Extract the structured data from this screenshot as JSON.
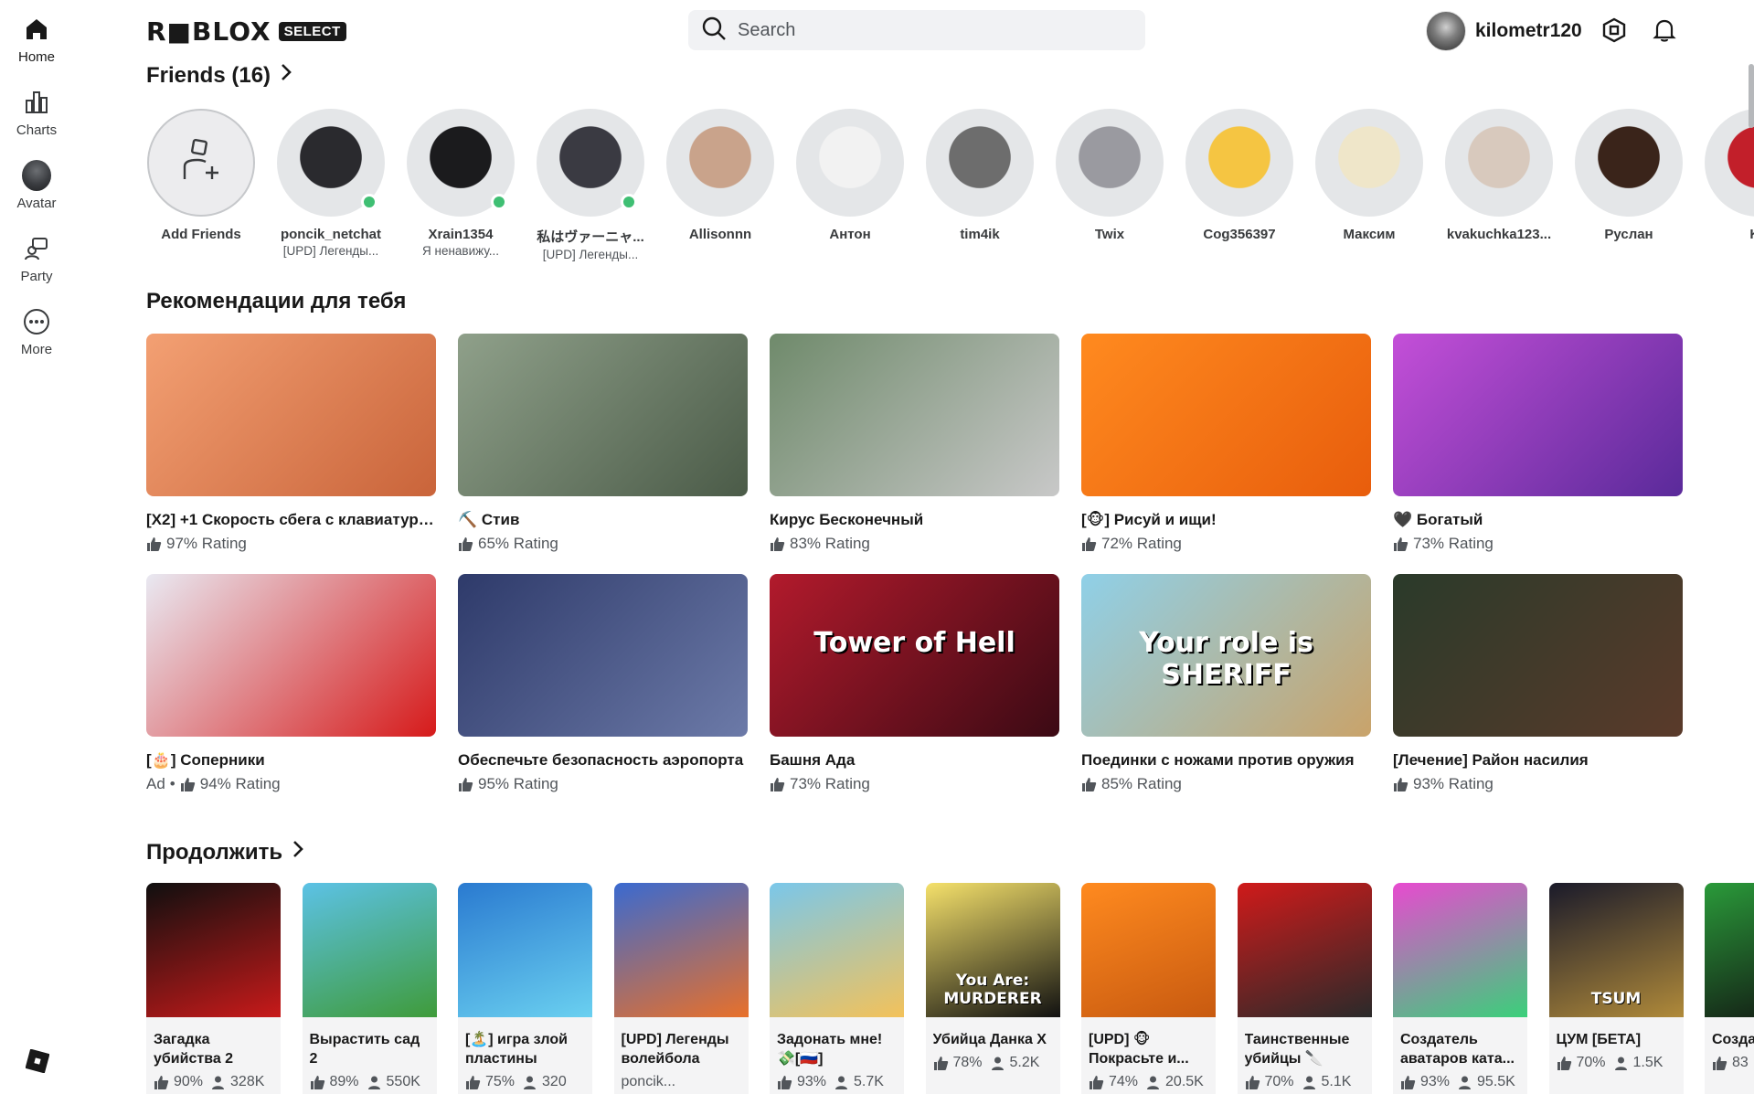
{
  "nav": {
    "items": [
      {
        "label": "Home",
        "icon": "home-icon"
      },
      {
        "label": "Charts",
        "icon": "charts-icon"
      },
      {
        "label": "Avatar",
        "icon": "avatar-icon"
      },
      {
        "label": "Party",
        "icon": "party-icon"
      },
      {
        "label": "More",
        "icon": "more-icon"
      }
    ]
  },
  "header": {
    "logo_text": "R■BLOX",
    "logo_badge": "SELECT",
    "search_placeholder": "Search",
    "username": "kilometr120"
  },
  "friends": {
    "title": "Friends (16)",
    "add_label": "Add Friends",
    "list": [
      {
        "name": "poncik_netchat",
        "status": "[UPD] Легенды...",
        "online": true,
        "color": "#2a2a2e"
      },
      {
        "name": "Xrain1354",
        "status": "Я ненавижу...",
        "online": true,
        "color": "#1b1b1d"
      },
      {
        "name": "私はヴァーニャ...",
        "status": "[UPD] Легенды...",
        "online": true,
        "color": "#3a3a42"
      },
      {
        "name": "Allisonnn",
        "status": "",
        "online": false,
        "color": "#c9a38b"
      },
      {
        "name": "Антон",
        "status": "",
        "online": false,
        "color": "#f2f2f2"
      },
      {
        "name": "tim4ik",
        "status": "",
        "online": false,
        "color": "#6d6d6d"
      },
      {
        "name": "Twix",
        "status": "",
        "online": false,
        "color": "#9a9aa0"
      },
      {
        "name": "Cog356397",
        "status": "",
        "online": false,
        "color": "#f5c542"
      },
      {
        "name": "Максим",
        "status": "",
        "online": false,
        "color": "#efe6c9"
      },
      {
        "name": "kvakuchka123...",
        "status": "",
        "online": false,
        "color": "#d8c9bd"
      },
      {
        "name": "Руслан",
        "status": "",
        "online": false,
        "color": "#3a241a"
      },
      {
        "name": "Ka",
        "status": "",
        "online": false,
        "color": "#c21f2a"
      }
    ]
  },
  "recommended": {
    "title": "Рекомендации для тебя",
    "games": [
      {
        "title": "[X2] +1 Скорость сбега с клавиатуры | ...",
        "ad": false,
        "rating": "97% Rating",
        "c1": "#f3a073",
        "c2": "#c9643a"
      },
      {
        "title": "⛏️ Стив",
        "ad": false,
        "rating": "65% Rating",
        "c1": "#8fa08a",
        "c2": "#4b5b48"
      },
      {
        "title": "Кирус Бесконечный",
        "ad": false,
        "rating": "83% Rating",
        "c1": "#6f8a6b",
        "c2": "#c8c8c8"
      },
      {
        "title": "[🐵] Рисуй и ищи!",
        "ad": false,
        "rating": "72% Rating",
        "c1": "#ff8a1f",
        "c2": "#e85d0c"
      },
      {
        "title": "🖤 Богатый",
        "ad": false,
        "rating": "73% Rating",
        "c1": "#c44fd8",
        "c2": "#5a2a9a"
      },
      {
        "title": "[🎂] Соперники",
        "ad": true,
        "ad_label": "Ad",
        "rating": "94% Rating",
        "c1": "#e9e9f2",
        "c2": "#d61a1a"
      },
      {
        "title": "Обеспечьте безопасность аэропорта",
        "ad": false,
        "rating": "95% Rating",
        "c1": "#2e3a6a",
        "c2": "#6c7aa8"
      },
      {
        "title": "Башня Ада",
        "ad": false,
        "rating": "73% Rating",
        "c1": "#b21a2c",
        "c2": "#3b0a14",
        "overlay": "Tower of Hell"
      },
      {
        "title": "Поединки с ножами против оружия",
        "ad": false,
        "rating": "85% Rating",
        "c1": "#8fd0e8",
        "c2": "#c9a36a",
        "overlay": "Your role is SHERIFF"
      },
      {
        "title": "[Лечение] Район насилия",
        "ad": false,
        "rating": "93% Rating",
        "c1": "#2a3a2a",
        "c2": "#5a3a2a"
      }
    ]
  },
  "continue": {
    "title": "Продолжить",
    "games": [
      {
        "title": "Загадка убийства 2",
        "rating": "90%",
        "players": "328K",
        "c1": "#0f0f0f",
        "c2": "#c81a1a"
      },
      {
        "title": "Вырастить сад 2",
        "rating": "89%",
        "players": "550K",
        "c1": "#5cc2e6",
        "c2": "#3f9b3a"
      },
      {
        "title": "[🏝️] игра злой пластины",
        "rating": "75%",
        "players": "320",
        "c1": "#2a7ad0",
        "c2": "#6ad0f0"
      },
      {
        "title": "[UPD] Легенды волейбола",
        "rating": "",
        "players": "",
        "creator": "poncik...",
        "c1": "#3a6ad0",
        "c2": "#e8702a"
      },
      {
        "title": "Задонать мне! 💸[🇷🇺]",
        "rating": "93%",
        "players": "5.7K",
        "c1": "#7ac7ea",
        "c2": "#f3c25a"
      },
      {
        "title": "Убийца Данка Х",
        "rating": "78%",
        "players": "5.2K",
        "c1": "#f5e16b",
        "c2": "#111111",
        "overlay": "You Are: MURDERER"
      },
      {
        "title": "[UPD] 🐵Покрасьте и...",
        "rating": "74%",
        "players": "20.5K",
        "c1": "#ff8a1f",
        "c2": "#c85a10"
      },
      {
        "title": "Таинственные убийцы 🔪",
        "rating": "70%",
        "players": "5.1K",
        "c1": "#d01a1a",
        "c2": "#2a2a2a"
      },
      {
        "title": "Создатель аватаров ката...",
        "rating": "93%",
        "players": "95.5K",
        "c1": "#e84ad0",
        "c2": "#3ad07a"
      },
      {
        "title": "ЦУМ [БЕТА]",
        "rating": "70%",
        "players": "1.5K",
        "c1": "#1a1a2a",
        "c2": "#b08a3a",
        "overlay": "TSUM"
      },
      {
        "title": "Созда футбо",
        "rating": "83",
        "players": "",
        "c1": "#2a9a3a",
        "c2": "#111111"
      }
    ]
  }
}
